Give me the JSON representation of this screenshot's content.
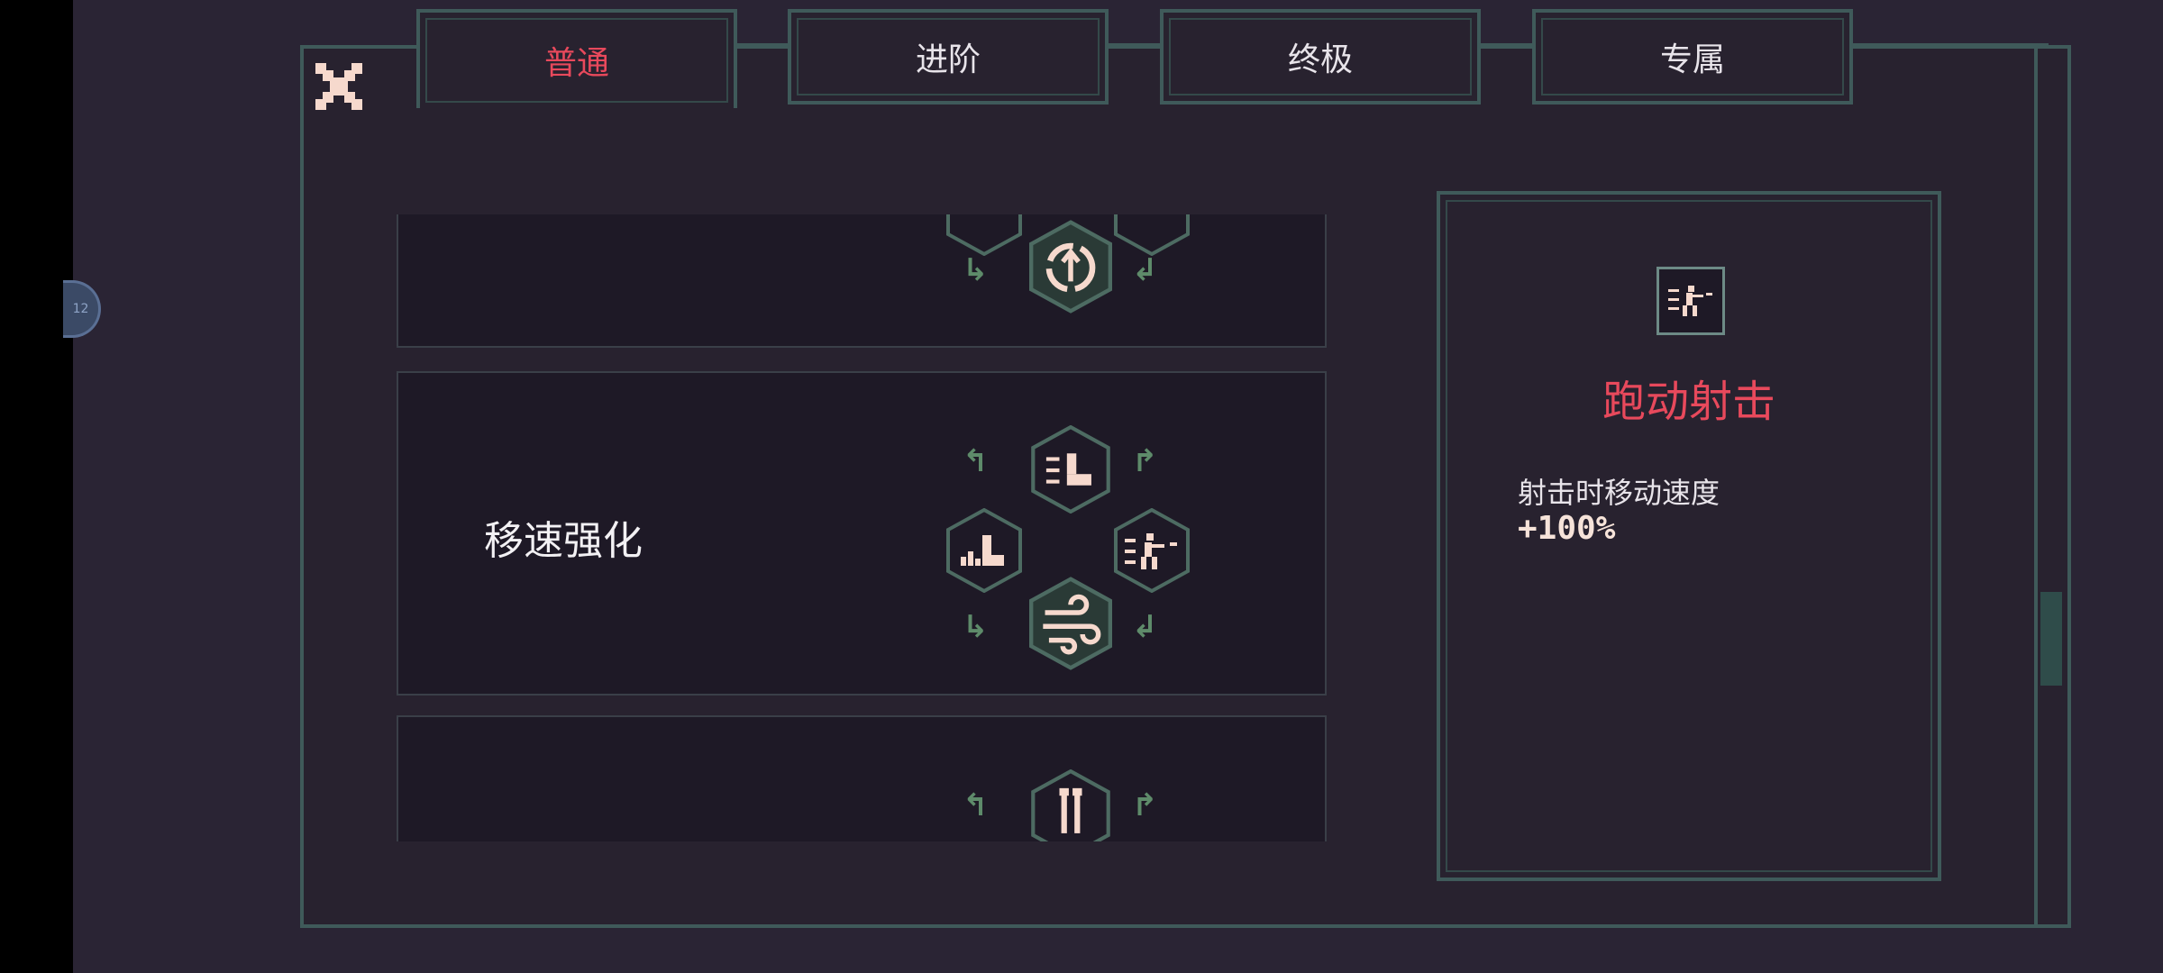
{
  "tabs": [
    {
      "label": "普通",
      "active": true
    },
    {
      "label": "进阶",
      "active": false
    },
    {
      "label": "终极",
      "active": false
    },
    {
      "label": "专属",
      "active": false
    }
  ],
  "close_icon": "close-x-icon",
  "float_bubble_text": "12",
  "skill_rows": [
    {
      "label": "",
      "icons": [
        "swirl-up-icon"
      ]
    },
    {
      "label": "移速强化",
      "icons": [
        "boot-dash-icon",
        "boot-fire-icon",
        "run-shoot-icon",
        "wind-icon"
      ]
    },
    {
      "label": "",
      "icons": [
        "twin-arrows-icon"
      ]
    }
  ],
  "detail": {
    "icon": "run-shoot-icon",
    "title": "跑动射击",
    "description": "射击时移动速度",
    "value": "+100%"
  },
  "colors": {
    "accent_red": "#e8495c",
    "frame": "#3f5a5a",
    "arrow_green": "#5e8b6a",
    "background": "#2a2434"
  }
}
